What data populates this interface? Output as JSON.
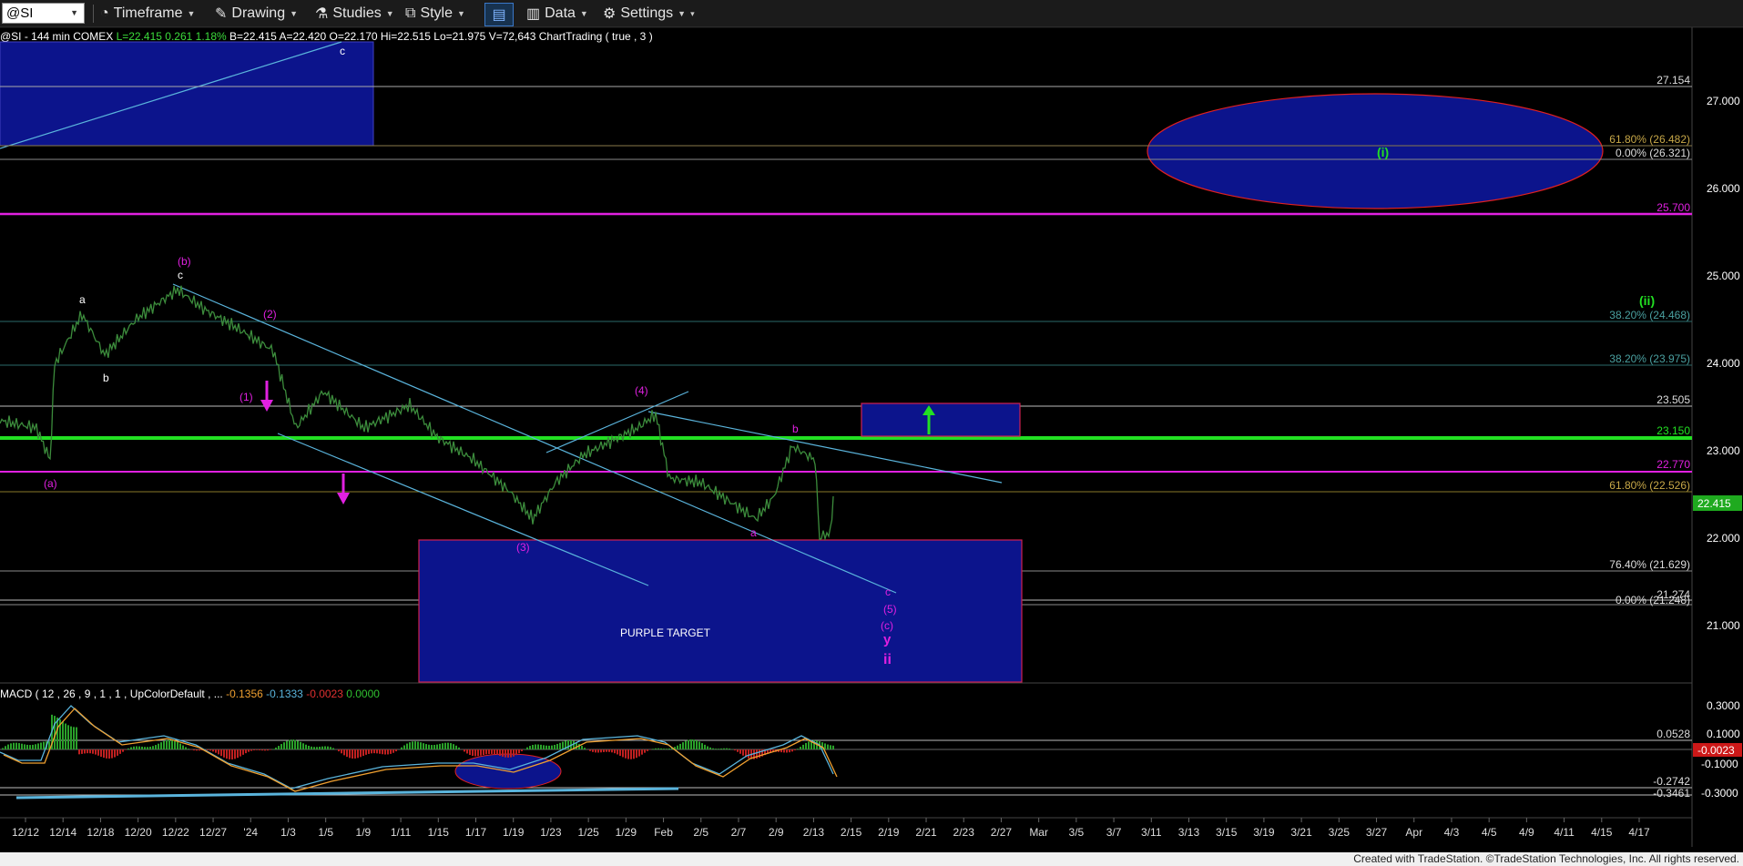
{
  "toolbar": {
    "symbol": "@SI",
    "timeframe": "Timeframe",
    "drawing": "Drawing",
    "studies": "Studies",
    "style": "Style",
    "data": "Data",
    "settings": "Settings"
  },
  "status": {
    "symbol_info": "@SI - 144 min  COMEX",
    "last": "L=22.415",
    "change": "0.261",
    "pct": "1.18%",
    "bid": "B=22.415",
    "ask": "A=22.420",
    "open": "O=22.170",
    "high": "Hi=22.515",
    "low": "Lo=21.975",
    "volume": "V=72,643",
    "indicator": "ChartTrading ( true , 3 )"
  },
  "price_axis": {
    "ticks": [
      "27.000",
      "26.000",
      "25.000",
      "24.000",
      "23.000",
      "22.000",
      "21.000"
    ],
    "current_price": "22.415",
    "levels": {
      "l27154": "27.154",
      "l25700": "25.700",
      "l23505": "23.505",
      "l23150": "23.150",
      "l22770": "22.770",
      "l21274": "21.274"
    },
    "fibs": {
      "f61_top": "61.80% (26.482)",
      "f0_top": "0.00% (26.321)",
      "f38a": "38.20% (24.468)",
      "f38b": "38.20% (23.975)",
      "f61b": "61.80% (22.526)",
      "f76": "76.40% (21.629)",
      "f0b": "0.00% (21.248)"
    }
  },
  "macd": {
    "label": "MACD ( 12 , 26 , 9 , 1 , 1 , UpColorDefault , ...",
    "v1": "-0.1356",
    "v2": "-0.1333",
    "v3": "-0.0023",
    "v4": "0.0000",
    "ticks": [
      "0.3000",
      "0.1000",
      "-0.1000",
      "-0.3000"
    ],
    "level_top": "0.0528",
    "level_mid": "-0.0023",
    "level_b1": "-0.2742",
    "level_b2": "-0.3461"
  },
  "time_axis": [
    "12/12",
    "12/14",
    "12/18",
    "12/20",
    "12/22",
    "12/27",
    "'24",
    "1/3",
    "1/5",
    "1/9",
    "1/11",
    "1/15",
    "1/17",
    "1/19",
    "1/23",
    "1/25",
    "1/29",
    "Feb",
    "2/5",
    "2/7",
    "2/9",
    "2/13",
    "2/15",
    "2/19",
    "2/21",
    "2/23",
    "2/27",
    "Mar",
    "3/5",
    "3/7",
    "3/11",
    "3/13",
    "3/15",
    "3/19",
    "3/21",
    "3/25",
    "3/27",
    "Apr",
    "4/3",
    "4/5",
    "4/9",
    "4/11",
    "4/15",
    "4/17"
  ],
  "annotations": {
    "a_paren": "(a)",
    "b_paren": "(b)",
    "c_small": "c",
    "a_small": "a",
    "b_small": "b",
    "w1": "(1)",
    "w2": "(2)",
    "w3": "(3)",
    "w4": "(4)",
    "w5": "(5)",
    "wc": "(c)",
    "y": "y",
    "ii": "ii",
    "i_green": "(i)",
    "ii_green": "(ii)",
    "b_late": "b",
    "a_late": "a",
    "c_late": "c",
    "c_top": "c",
    "purple_target": "PURPLE TARGET"
  },
  "colors": {
    "magenta": "#e020e0",
    "green": "#22e022",
    "navy": "#0c148c",
    "cyan": "#5ab4dc",
    "price": "#3c8c3c"
  },
  "footer": "Created with TradeStation. ©TradeStation Technologies, Inc. All rights reserved."
}
